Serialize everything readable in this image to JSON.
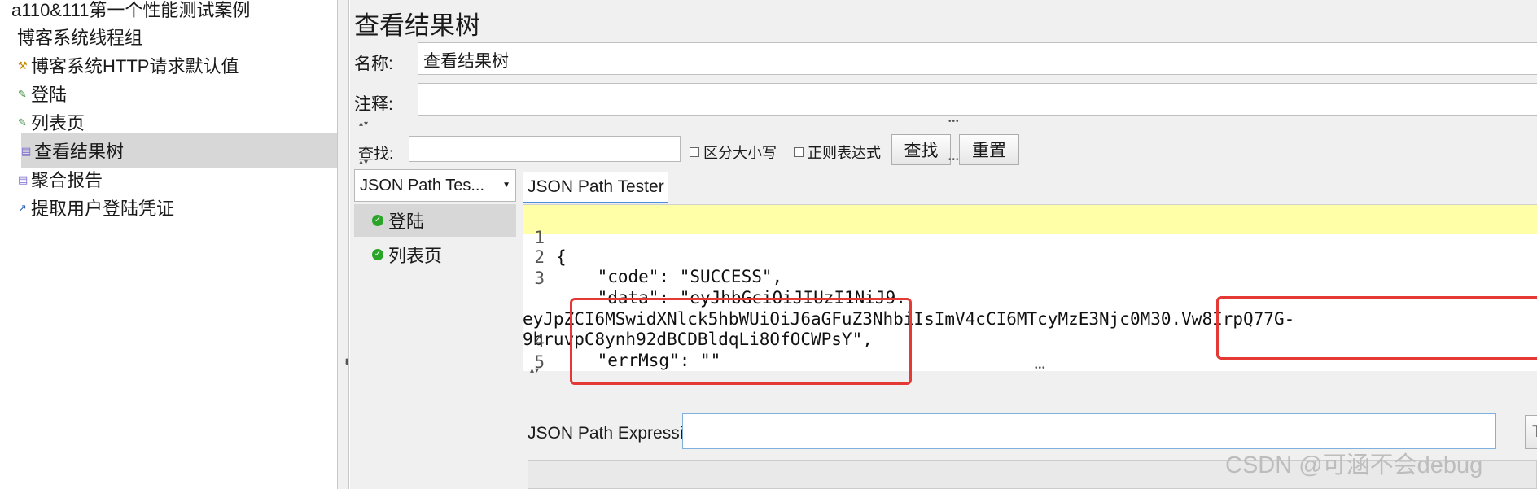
{
  "tree": {
    "items": [
      {
        "label": "a110&111第一个性能测试案例",
        "icon": ""
      },
      {
        "label": "博客系统线程组",
        "icon": ""
      },
      {
        "label": "博客系统HTTP请求默认值",
        "icon": "wrench-icon"
      },
      {
        "label": "登陆",
        "icon": "pencil-icon"
      },
      {
        "label": "列表页",
        "icon": "pencil-icon"
      },
      {
        "label": "查看结果树",
        "icon": "chart-icon"
      },
      {
        "label": "聚合报告",
        "icon": "chart-icon"
      },
      {
        "label": "提取用户登陆凭证",
        "icon": "arrow-icon"
      }
    ],
    "selected_index": 5
  },
  "panel": {
    "title": "查看结果树",
    "name_label": "名称:",
    "name_value": "查看结果树",
    "comment_label": "注释:",
    "comment_value": ""
  },
  "search": {
    "label": "查找:",
    "value": "",
    "case_sensitive_label": "区分大小写",
    "regex_label": "正则表达式",
    "find_button": "查找",
    "reset_button": "重置"
  },
  "renderer": {
    "selected": "JSON Path Tes..."
  },
  "results": [
    {
      "label": "登陆",
      "status": "success"
    },
    {
      "label": "列表页",
      "status": "success"
    }
  ],
  "tester": {
    "tab_label": "JSON Path Tester",
    "code_lines": [
      {
        "num": "1",
        "text": "{"
      },
      {
        "num": "2",
        "text": "    \"code\": \"SUCCESS\","
      },
      {
        "num": "3",
        "text": "    \"data\": \"eyJhbGciOiJIUzI1NiJ9."
      },
      {
        "num": "",
        "text": "eyJpZCI6MSwidXNlck5hbWUiOiJ6aGFuZ3NhbiIsImV4cCI6MTcyMzE3Njc0M30.Vw8IrpQ77G-"
      },
      {
        "num": "",
        "text": "9bruvpC8ynh92dBCDBldqLi8OfOCWPsY\","
      },
      {
        "num": "4",
        "text": "    \"errMsg\": \"\""
      },
      {
        "num": "5",
        "text": "}"
      }
    ],
    "expression_label": "JSON Path Expression",
    "expression_value": "",
    "test_button": "Test"
  },
  "watermark": "CSDN @可涵不会debug",
  "colors": {
    "highlight_line": "#ffffa8",
    "annotation_red": "#e53935",
    "selected_row": "#d7d7d7",
    "success_green": "#2aa52a"
  }
}
